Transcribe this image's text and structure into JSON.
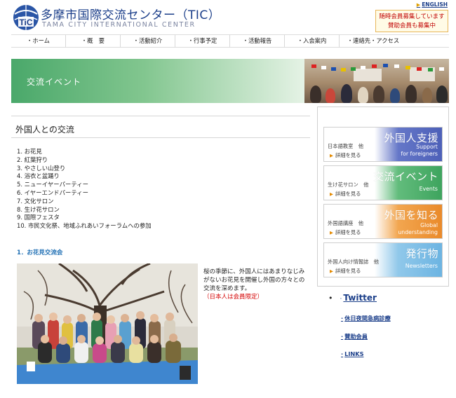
{
  "header": {
    "title": "多摩市国際交流センター（TIC）",
    "subtitle": "TAMA CITY INTERNATIONAL CENTER",
    "lang_link": "ENGLISH",
    "notice": [
      "随時会員募集しています",
      "賛助会員も募集中"
    ]
  },
  "nav": {
    "items": [
      "・ホーム",
      "・概　要",
      "・活動紹介",
      "・行事予定",
      "・活動報告",
      "・入会案内",
      "・連絡先・アクセス"
    ]
  },
  "banner": {
    "title": "交流イベント"
  },
  "main": {
    "heading": "外国人との交流",
    "events": [
      "1.  お花見",
      "2.  紅葉狩り",
      "3.  やさしい山登り",
      "4.  浴衣と盆踊り",
      "5.  ニューイヤーパーティー",
      "6.  イヤーエンドパーティー",
      "7.  文化サロン",
      "8.  生け花サロン",
      "9.  国際フェスタ",
      "10.  市民文化祭、地域ふれあいフォーラムへの参加"
    ],
    "sub_heading": "1．お花見交流会",
    "photo_text": "桜の季節に、外国人にはあまりなじみがないお花見を開催し外国の方々との交流を深めます。",
    "photo_note": "（日本人は会員限定）"
  },
  "sidebar": {
    "cards": [
      {
        "big": "外国人支援",
        "small1": "Support",
        "small2": "for foreigners",
        "label": "日本語教室　他",
        "more": "詳細を見る",
        "color": "#5a6fc4"
      },
      {
        "big": "交流イベント",
        "small1": "Events",
        "small2": "",
        "label": "生け花サロン　他",
        "more": "詳細を見る",
        "color": "#4cae6a"
      },
      {
        "big": "外国を知る",
        "small1": "Global",
        "small2": "understanding",
        "label": "外国語講座　他",
        "more": "詳細を見る",
        "color": "#ef9a3c"
      },
      {
        "big": "発行物",
        "small1": "Newsletters",
        "small2": "",
        "label": "外国人向け情報誌　他",
        "more": "詳細を見る",
        "color": "#7fbde6"
      }
    ],
    "twitter": "Twitter",
    "links": [
      "休日夜間急病診療",
      "賛助会員",
      "LINKS"
    ]
  }
}
